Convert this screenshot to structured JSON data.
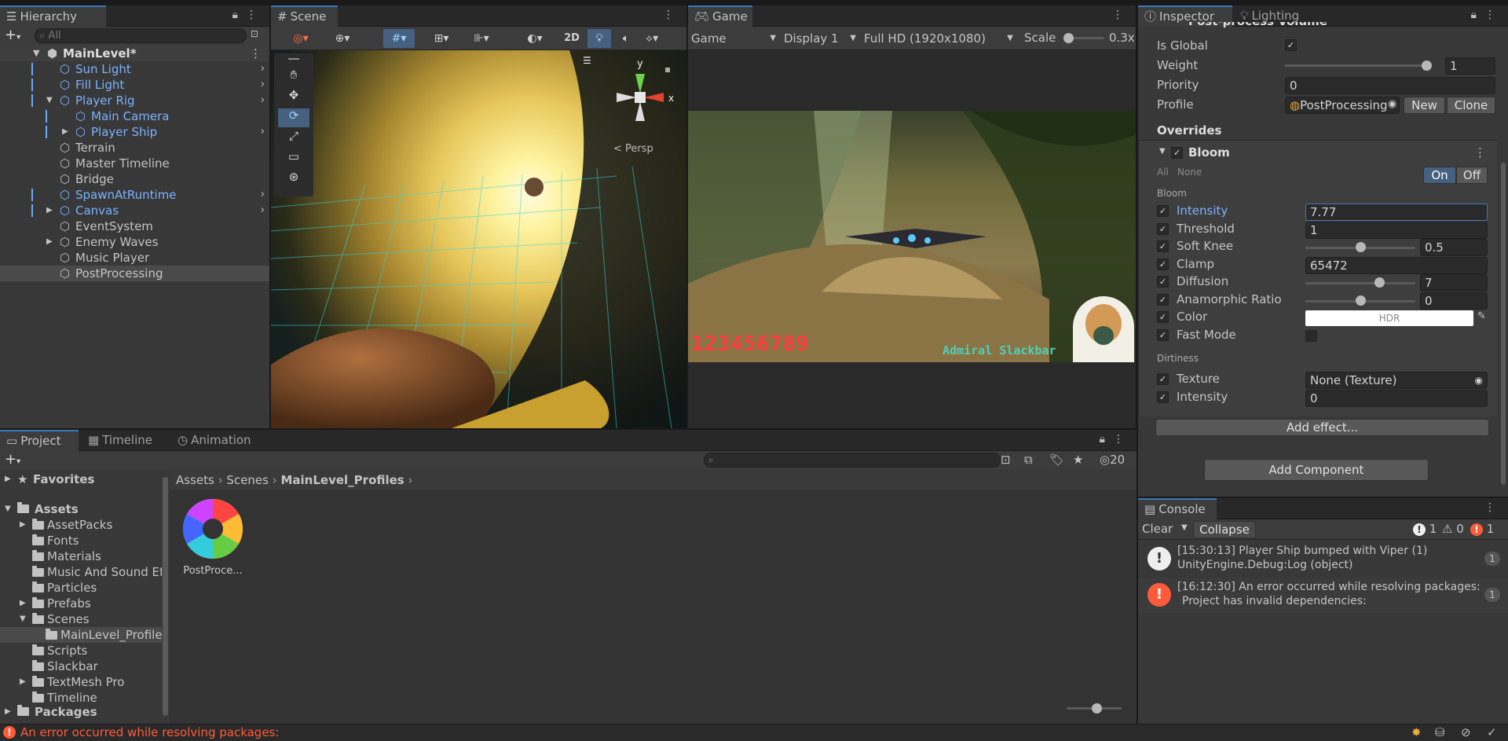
{
  "hierarchy": {
    "tab": "Hierarchy",
    "search_placeholder": "All",
    "scene": "MainLevel*",
    "items": [
      {
        "label": "Sun Light",
        "blue": true,
        "indent": 1,
        "arrow": false,
        "more": true
      },
      {
        "label": "Fill Light",
        "blue": true,
        "indent": 1,
        "arrow": false,
        "more": true
      },
      {
        "label": "Player Rig",
        "blue": true,
        "indent": 1,
        "arrow": "down",
        "more": true
      },
      {
        "label": "Main Camera",
        "blue": true,
        "indent": 2,
        "arrow": false,
        "more": false
      },
      {
        "label": "Player Ship",
        "blue": true,
        "indent": 2,
        "arrow": "right",
        "more": true
      },
      {
        "label": "Terrain",
        "blue": false,
        "indent": 1,
        "arrow": false,
        "more": false
      },
      {
        "label": "Master Timeline",
        "blue": false,
        "indent": 1,
        "arrow": false,
        "more": false
      },
      {
        "label": "Bridge",
        "blue": false,
        "indent": 1,
        "arrow": false,
        "more": false
      },
      {
        "label": "SpawnAtRuntime",
        "blue": true,
        "indent": 1,
        "arrow": false,
        "more": true
      },
      {
        "label": "Canvas",
        "blue": true,
        "indent": 1,
        "arrow": "right",
        "more": true
      },
      {
        "label": "EventSystem",
        "blue": false,
        "indent": 1,
        "arrow": false,
        "more": false
      },
      {
        "label": "Enemy Waves",
        "blue": false,
        "indent": 1,
        "arrow": "right",
        "more": false
      },
      {
        "label": "Music Player",
        "blue": false,
        "indent": 1,
        "arrow": false,
        "more": false
      },
      {
        "label": "PostProcessing",
        "blue": false,
        "indent": 1,
        "arrow": false,
        "more": false,
        "selected": true
      }
    ]
  },
  "scene": {
    "tab": "Scene",
    "btn_2d": "2D",
    "persp": "< Persp",
    "gizmo_y": "y",
    "gizmo_x": "x"
  },
  "game": {
    "tab": "Game",
    "mode": "Game",
    "display": "Display 1",
    "resolution": "Full HD (1920x1080)",
    "scale_label": "Scale",
    "scale_value": "0.3x",
    "scale_fraction": 0.0,
    "hud_score": "123456789",
    "hud_name": "Admiral Slackbar"
  },
  "inspector": {
    "tab_inspector": "Inspector",
    "tab_lighting": "Lighting",
    "header": "Post-process Volume",
    "is_global_label": "Is Global",
    "weight_label": "Weight",
    "weight_value": "1",
    "weight_fraction": 1.0,
    "priority_label": "Priority",
    "priority_value": "0",
    "profile_label": "Profile",
    "profile_value": "PostProcessing",
    "new_btn": "New",
    "clone_btn": "Clone",
    "overrides": "Overrides",
    "bloom_title": "Bloom",
    "all": "All",
    "none": "None",
    "on": "On",
    "off": "Off",
    "bloom_section": "Bloom",
    "props": [
      {
        "label": "Intensity",
        "value": "7.77",
        "slider": null,
        "highlight": true
      },
      {
        "label": "Threshold",
        "value": "1",
        "slider": null
      },
      {
        "label": "Soft Knee",
        "value": "0.5",
        "slider": 0.5
      },
      {
        "label": "Clamp",
        "value": "65472",
        "slider": null
      },
      {
        "label": "Diffusion",
        "value": "7",
        "slider": 0.67
      },
      {
        "label": "Anamorphic Ratio",
        "value": "0",
        "slider": 0.5
      },
      {
        "label": "Color",
        "value": "HDR",
        "color": true
      },
      {
        "label": "Fast Mode",
        "value": "",
        "checkbox": true
      }
    ],
    "dirtiness_section": "Dirtiness",
    "texture_label": "Texture",
    "texture_value": "None (Texture)",
    "dirt_intensity_label": "Intensity",
    "dirt_intensity_value": "0",
    "add_effect": "Add effect...",
    "add_component": "Add Component"
  },
  "console": {
    "tab": "Console",
    "clear": "Clear",
    "collapse": "Collapse",
    "count_log": "1",
    "count_warn": "0",
    "count_err": "1",
    "entries": [
      {
        "type": "log",
        "line1": "[15:30:13] Player Ship bumped with Viper (1)",
        "line2": "UnityEngine.Debug:Log (object)",
        "count": "1"
      },
      {
        "type": "error",
        "line1": "[16:12:30] An error occurred while resolving packages:",
        "line2": "Project has invalid dependencies:",
        "count": "1"
      }
    ]
  },
  "project": {
    "tab_project": "Project",
    "tab_timeline": "Timeline",
    "tab_animation": "Animation",
    "hidden_count": "20",
    "favorites": "Favorites",
    "assets": "Assets",
    "folders": [
      {
        "label": "AssetPacks",
        "arrow": true,
        "indent": 1
      },
      {
        "label": "Fonts",
        "arrow": false,
        "indent": 1
      },
      {
        "label": "Materials",
        "arrow": false,
        "indent": 1
      },
      {
        "label": "Music And Sound Ef",
        "arrow": false,
        "indent": 1
      },
      {
        "label": "Particles",
        "arrow": false,
        "indent": 1
      },
      {
        "label": "Prefabs",
        "arrow": true,
        "indent": 1
      },
      {
        "label": "Scenes",
        "arrow": "down",
        "indent": 1
      },
      {
        "label": "MainLevel_Profile",
        "arrow": false,
        "indent": 2,
        "selected": true
      },
      {
        "label": "Scripts",
        "arrow": false,
        "indent": 1
      },
      {
        "label": "Slackbar",
        "arrow": false,
        "indent": 1
      },
      {
        "label": "TextMesh Pro",
        "arrow": true,
        "indent": 1
      },
      {
        "label": "Timeline",
        "arrow": false,
        "indent": 1
      }
    ],
    "packages": "Packages",
    "breadcrumb": [
      "Assets",
      "Scenes",
      "MainLevel_Profiles"
    ],
    "asset_name": "PostProce..."
  },
  "status": {
    "message": "An error occurred while resolving packages:"
  },
  "colors": {
    "accent": "#3a79bb",
    "prefab_blue": "#7ab2ff",
    "error": "#ff5b3a"
  }
}
